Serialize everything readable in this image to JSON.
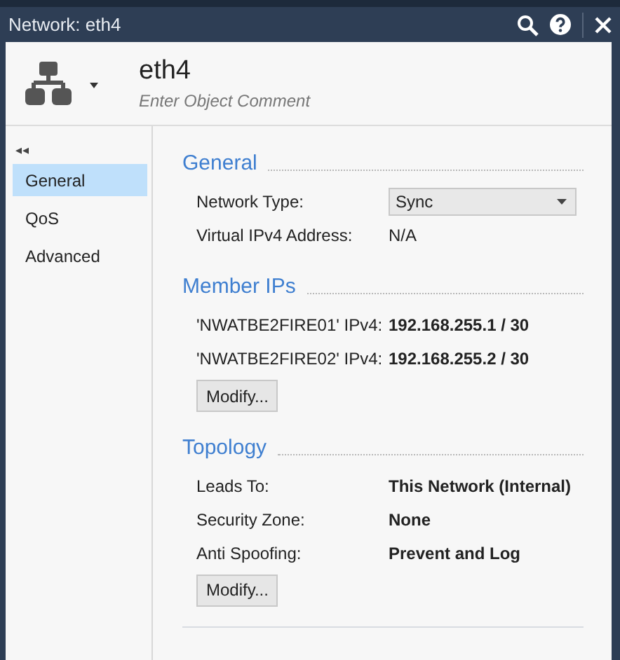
{
  "window": {
    "title": "Network: eth4"
  },
  "header": {
    "name": "eth4",
    "comment_placeholder": "Enter Object Comment"
  },
  "sidebar": {
    "collapse": "◂◂",
    "items": [
      {
        "label": "General",
        "selected": true
      },
      {
        "label": "QoS",
        "selected": false
      },
      {
        "label": "Advanced",
        "selected": false
      }
    ]
  },
  "sections": [
    {
      "title": "General",
      "rows": [
        {
          "kind": "select",
          "label": "Network Type:",
          "value": "Sync"
        },
        {
          "kind": "text",
          "label": "Virtual IPv4 Address:",
          "value": "N/A"
        }
      ]
    },
    {
      "title": "Member IPs",
      "rows": [
        {
          "kind": "bold",
          "label": "'NWATBE2FIRE01' IPv4:",
          "value": "192.168.255.1 / 30"
        },
        {
          "kind": "bold",
          "label": "'NWATBE2FIRE02' IPv4:",
          "value": "192.168.255.2 / 30"
        }
      ],
      "button": "Modify..."
    },
    {
      "title": "Topology",
      "rows": [
        {
          "kind": "bold",
          "label": "Leads To:",
          "value": "This Network (Internal)"
        },
        {
          "kind": "bold",
          "label": "Security Zone:",
          "value": "None"
        },
        {
          "kind": "bold",
          "label": "Anti Spoofing:",
          "value": "Prevent and Log"
        }
      ],
      "button": "Modify..."
    }
  ]
}
